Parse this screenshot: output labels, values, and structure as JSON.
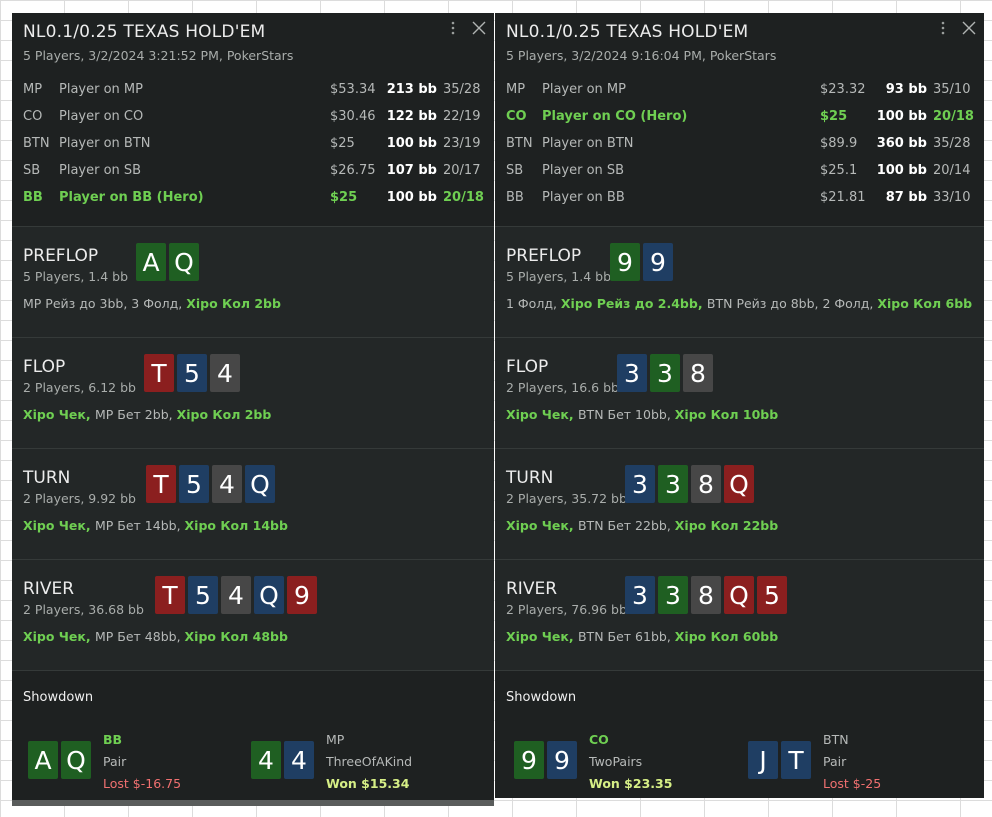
{
  "hands": [
    {
      "title": "NL0.1/0.25 TEXAS HOLD'EM",
      "subtitle": "5 Players, 3/2/2024 3:21:52 PM, PokerStars",
      "players": [
        {
          "pos": "MP",
          "name": "Player on MP",
          "stack": "$53.34",
          "bb": "213 bb",
          "stat": "35/28",
          "hero": false
        },
        {
          "pos": "CO",
          "name": "Player on CO",
          "stack": "$30.46",
          "bb": "122 bb",
          "stat": "22/19",
          "hero": false
        },
        {
          "pos": "BTN",
          "name": "Player on BTN",
          "stack": "$25",
          "bb": "100 bb",
          "stat": "23/19",
          "hero": false
        },
        {
          "pos": "SB",
          "name": "Player on SB",
          "stack": "$26.75",
          "bb": "107 bb",
          "stat": "20/17",
          "hero": false
        },
        {
          "pos": "BB",
          "name": "Player on BB (Hero)",
          "stack": "$25",
          "bb": "100 bb",
          "stat": "20/18",
          "hero": true
        }
      ],
      "streets": [
        {
          "name": "PREFLOP",
          "sub": "5 Players, 1.4 bb",
          "cards": [
            {
              "rank": "A",
              "suit": "c"
            },
            {
              "rank": "Q",
              "suit": "c"
            }
          ],
          "actions": [
            {
              "text": "MP Рейз до 3bb, 3 Фолд, ",
              "hero": false
            },
            {
              "text": "Хіро Кол 2bb",
              "hero": true
            }
          ]
        },
        {
          "name": "FLOP",
          "sub": "2 Players, 6.12 bb",
          "cards": [
            {
              "rank": "T",
              "suit": "h"
            },
            {
              "rank": "5",
              "suit": "d"
            },
            {
              "rank": "4",
              "suit": "s"
            }
          ],
          "actions": [
            {
              "text": "Хіро Чек, ",
              "hero": true
            },
            {
              "text": "MP Бет 2bb, ",
              "hero": false
            },
            {
              "text": "Хіро Кол 2bb",
              "hero": true
            }
          ]
        },
        {
          "name": "TURN",
          "sub": "2 Players, 9.92 bb",
          "cards": [
            {
              "rank": "T",
              "suit": "h"
            },
            {
              "rank": "5",
              "suit": "d"
            },
            {
              "rank": "4",
              "suit": "s"
            },
            {
              "rank": "Q",
              "suit": "d"
            }
          ],
          "actions": [
            {
              "text": "Хіро Чек, ",
              "hero": true
            },
            {
              "text": "MP Бет 14bb, ",
              "hero": false
            },
            {
              "text": "Хіро Кол 14bb",
              "hero": true
            }
          ]
        },
        {
          "name": "RIVER",
          "sub": "2 Players, 36.68 bb",
          "cards": [
            {
              "rank": "T",
              "suit": "h"
            },
            {
              "rank": "5",
              "suit": "d"
            },
            {
              "rank": "4",
              "suit": "s"
            },
            {
              "rank": "Q",
              "suit": "d"
            },
            {
              "rank": "9",
              "suit": "h"
            }
          ],
          "actions": [
            {
              "text": "Хіро Чек, ",
              "hero": true
            },
            {
              "text": "MP Бет 48bb, ",
              "hero": false
            },
            {
              "text": "Хіро Кол 48bb",
              "hero": true
            }
          ]
        }
      ],
      "showdown": {
        "title": "Showdown",
        "players": [
          {
            "pos": "BB",
            "hero": true,
            "hand": "Pair",
            "result": "Lost $-16.75",
            "won": false,
            "cards": [
              {
                "rank": "A",
                "suit": "c"
              },
              {
                "rank": "Q",
                "suit": "c"
              }
            ]
          },
          {
            "pos": "MP",
            "hero": false,
            "hand": "ThreeOfAKind",
            "result": "Won $15.34",
            "won": true,
            "cards": [
              {
                "rank": "4",
                "suit": "c"
              },
              {
                "rank": "4",
                "suit": "d"
              }
            ]
          }
        ]
      }
    },
    {
      "title": "NL0.1/0.25 TEXAS HOLD'EM",
      "subtitle": "5 Players, 3/2/2024 9:16:04 PM, PokerStars",
      "players": [
        {
          "pos": "MP",
          "name": "Player on MP",
          "stack": "$23.32",
          "bb": "93 bb",
          "stat": "35/10",
          "hero": false
        },
        {
          "pos": "CO",
          "name": "Player on CO (Hero)",
          "stack": "$25",
          "bb": "100 bb",
          "stat": "20/18",
          "hero": true
        },
        {
          "pos": "BTN",
          "name": "Player on BTN",
          "stack": "$89.9",
          "bb": "360 bb",
          "stat": "35/28",
          "hero": false
        },
        {
          "pos": "SB",
          "name": "Player on SB",
          "stack": "$25.1",
          "bb": "100 bb",
          "stat": "20/14",
          "hero": false
        },
        {
          "pos": "BB",
          "name": "Player on BB",
          "stack": "$21.81",
          "bb": "87 bb",
          "stat": "33/10",
          "hero": false
        }
      ],
      "streets": [
        {
          "name": "PREFLOP",
          "sub": "5 Players, 1.4 bb",
          "cards": [
            {
              "rank": "9",
              "suit": "c"
            },
            {
              "rank": "9",
              "suit": "d"
            }
          ],
          "actions": [
            {
              "text": "1 Фолд, ",
              "hero": false
            },
            {
              "text": "Хіро Рейз до 2.4bb, ",
              "hero": true
            },
            {
              "text": "BTN Рейз до 8bb, 2 Фолд, ",
              "hero": false
            },
            {
              "text": "Хіро Кол 6bb",
              "hero": true
            }
          ]
        },
        {
          "name": "FLOP",
          "sub": "2 Players, 16.6 bb",
          "cards": [
            {
              "rank": "3",
              "suit": "d"
            },
            {
              "rank": "3",
              "suit": "c"
            },
            {
              "rank": "8",
              "suit": "s"
            }
          ],
          "actions": [
            {
              "text": "Хіро Чек, ",
              "hero": true
            },
            {
              "text": "BTN Бет 10bb, ",
              "hero": false
            },
            {
              "text": "Хіро Кол 10bb",
              "hero": true
            }
          ]
        },
        {
          "name": "TURN",
          "sub": "2 Players, 35.72 bb",
          "cards": [
            {
              "rank": "3",
              "suit": "d"
            },
            {
              "rank": "3",
              "suit": "c"
            },
            {
              "rank": "8",
              "suit": "s"
            },
            {
              "rank": "Q",
              "suit": "h"
            }
          ],
          "actions": [
            {
              "text": "Хіро Чек, ",
              "hero": true
            },
            {
              "text": "BTN Бет 22bb, ",
              "hero": false
            },
            {
              "text": "Хіро Кол 22bb",
              "hero": true
            }
          ]
        },
        {
          "name": "RIVER",
          "sub": "2 Players, 76.96 bb",
          "cards": [
            {
              "rank": "3",
              "suit": "d"
            },
            {
              "rank": "3",
              "suit": "c"
            },
            {
              "rank": "8",
              "suit": "s"
            },
            {
              "rank": "Q",
              "suit": "h"
            },
            {
              "rank": "5",
              "suit": "h"
            }
          ],
          "actions": [
            {
              "text": "Хіро Чек, ",
              "hero": true
            },
            {
              "text": "BTN Бет 61bb, ",
              "hero": false
            },
            {
              "text": "Хіро Кол 60bb",
              "hero": true
            }
          ]
        }
      ],
      "showdown": {
        "title": "Showdown",
        "players": [
          {
            "pos": "CO",
            "hero": true,
            "hand": "TwoPairs",
            "result": "Won $23.35",
            "won": true,
            "cards": [
              {
                "rank": "9",
                "suit": "c"
              },
              {
                "rank": "9",
                "suit": "d"
              }
            ]
          },
          {
            "pos": "BTN",
            "hero": false,
            "hand": "Pair",
            "result": "Lost $-25",
            "won": false,
            "cards": [
              {
                "rank": "J",
                "suit": "d"
              },
              {
                "rank": "T",
                "suit": "d"
              }
            ]
          }
        ]
      }
    }
  ],
  "icons": {
    "menu": "more-vertical-icon",
    "close": "close-icon"
  },
  "colors": {
    "panel_bg": "#1e2121",
    "street_bg": "#232727",
    "hero_green": "#6fcf52",
    "lost_red": "#f07070",
    "won_yellow": "#d6ef86",
    "heart": "#8b1f1f",
    "diamond": "#1f3e63",
    "club": "#1f5f22",
    "spade": "#474747"
  }
}
